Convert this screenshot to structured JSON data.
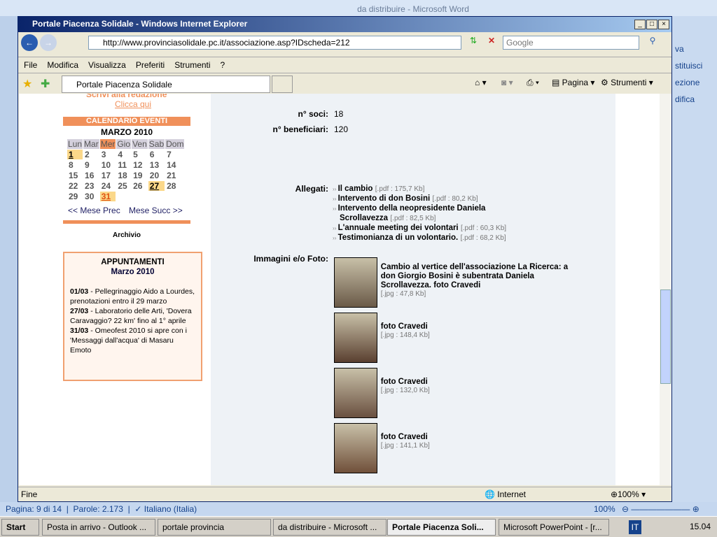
{
  "word": {
    "title": "da distribuire - Microsoft Word",
    "status": {
      "page": "Pagina: 9 di 14",
      "words": "Parole: 2.173",
      "language": "Italiano (Italia)",
      "zoom": "100%"
    },
    "ribbon_right": [
      "va",
      "stituisci",
      "ezione",
      "difica"
    ]
  },
  "ie": {
    "title": "Portale Piacenza Solidale - Windows Internet Explorer",
    "url": "http://www.provinciasolidale.pc.it/associazione.asp?IDscheda=212",
    "search_placeholder": "Google",
    "menu": [
      "File",
      "Modifica",
      "Visualizza",
      "Preferiti",
      "Strumenti",
      "?"
    ],
    "tab": "Portale Piacenza Solidale",
    "toolbar": {
      "page": "Pagina",
      "tools": "Strumenti"
    },
    "status": "Fine",
    "zone": "Internet",
    "zoom": "100%"
  },
  "sidebar": {
    "write": "Scrivi alla redazione",
    "click": "Clicca qui",
    "calendar": {
      "title": "CALENDARIO EVENTI",
      "month": "MARZO 2010",
      "days": [
        "Lun",
        "Mar",
        "Mer",
        "Gio",
        "Ven",
        "Sab",
        "Dom"
      ],
      "weeks": [
        [
          "1",
          "2",
          "3",
          "4",
          "5",
          "6",
          "7"
        ],
        [
          "8",
          "9",
          "10",
          "11",
          "12",
          "13",
          "14"
        ],
        [
          "15",
          "16",
          "17",
          "18",
          "19",
          "20",
          "21"
        ],
        [
          "22",
          "23",
          "24",
          "25",
          "26",
          "27",
          "28"
        ],
        [
          "29",
          "30",
          "31",
          "",
          "",
          "",
          ""
        ]
      ],
      "prev": "<< Mese Prec",
      "next": "Mese Succ >>"
    },
    "archive": "Archivio",
    "appointments": {
      "title": "APPUNTAMENTI",
      "month": "Marzo 2010",
      "items": [
        {
          "date": "01/03",
          "text": " - Pellegrinaggio Aido a Lourdes, prenotazioni entro il 29 marzo"
        },
        {
          "date": "27/03",
          "text": " - Laboratorio delle Arti, 'Dovera Caravaggio? 22 km' fino al 1° aprile"
        },
        {
          "date": "31/03",
          "text": " - Omeofest 2010 si apre con i 'Messaggi dall'acqua' di Masaru Emoto"
        }
      ]
    }
  },
  "main": {
    "soci_label": "n° soci:",
    "soci": "18",
    "benef_label": "n° beneficiari:",
    "benef": "120",
    "attach_label": "Allegati:",
    "attachments": [
      {
        "name": "Il cambio",
        "size": "[.pdf : 175,7 Kb]"
      },
      {
        "name": "Intervento di don Bosini",
        "size": "[.pdf : 80,2 Kb]"
      },
      {
        "name": "Intervento della neopresidente Daniela Scrollavezza",
        "size": "[.pdf : 82,5 Kb]"
      },
      {
        "name": "L'annuale meeting dei volontari",
        "size": "[.pdf : 60,3 Kb]"
      },
      {
        "name": "Testimonianza di un volontario.",
        "size": "[.pdf : 68,2 Kb]"
      }
    ],
    "images_label": "Immagini e/o Foto:",
    "images": [
      {
        "caption": "Cambio al vertice dell'associazione La Ricerca: a don Giorgio Bosini è subentrata Daniela Scrollavezza. foto Cravedi",
        "size": "[.jpg : 47,8 Kb]"
      },
      {
        "caption": "foto Cravedi",
        "size": "[.jpg : 148,4 Kb]"
      },
      {
        "caption": "foto Cravedi",
        "size": "[.jpg : 132,0 Kb]"
      },
      {
        "caption": "foto Cravedi",
        "size": "[.jpg : 141,1 Kb]"
      }
    ]
  },
  "taskbar": {
    "start": "Start",
    "items": [
      "Posta in arrivo - Outlook ...",
      "portale provincia",
      "da distribuire - Microsoft ...",
      "Portale Piacenza Soli...",
      "Microsoft PowerPoint - [r..."
    ],
    "lang": "IT",
    "clock": "15.04"
  }
}
